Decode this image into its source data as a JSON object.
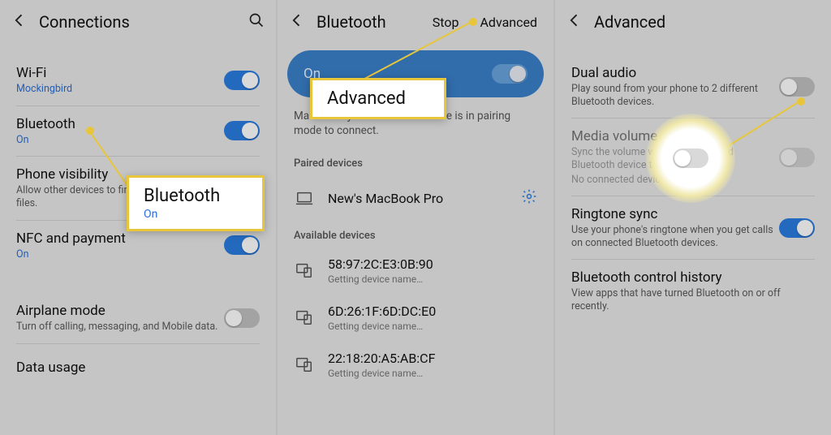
{
  "screen1": {
    "title": "Connections",
    "wifi": {
      "title": "Wi-Fi",
      "sub": "Mockingbird",
      "on": true
    },
    "bluetooth": {
      "title": "Bluetooth",
      "sub": "On",
      "on": true
    },
    "visibility": {
      "title": "Phone visibility",
      "sub": "Allow other devices to find your phone and transfer files."
    },
    "nfc": {
      "title": "NFC and payment",
      "sub": "On",
      "on": true
    },
    "airplane": {
      "title": "Airplane mode",
      "sub": "Turn off calling, messaging, and Mobile data.",
      "on": false
    },
    "data": {
      "title": "Data usage"
    },
    "callout": {
      "title": "Bluetooth",
      "sub": "On"
    }
  },
  "screen2": {
    "title": "Bluetooth",
    "stop": "Stop",
    "advanced": "Advanced",
    "pill_label": "On",
    "hint": "Make sure your Bluetooth device is in pairing mode to connect.",
    "paired_header": "Paired devices",
    "available_header": "Available devices",
    "paired": {
      "name": "New's MacBook Pro"
    },
    "avail": [
      {
        "mac": "58:97:2C:E3:0B:90",
        "status": "Getting device name…"
      },
      {
        "mac": "6D:26:1F:6D:DC:E0",
        "status": "Getting device name…"
      },
      {
        "mac": "22:18:20:A5:AB:CF",
        "status": "Getting device name…"
      }
    ],
    "callout": {
      "title": "Advanced"
    }
  },
  "screen3": {
    "title": "Advanced",
    "dual": {
      "title": "Dual audio",
      "sub": "Play sound from your phone to 2 different Bluetooth devices."
    },
    "media": {
      "title": "Media volume sync",
      "sub": "Sync the volume with the connected Bluetooth device to your phone.",
      "sub2": "No connected devices"
    },
    "ring": {
      "title": "Ringtone sync",
      "sub": "Use your phone's ringtone when you get calls on connected Bluetooth devices."
    },
    "history": {
      "title": "Bluetooth control history",
      "sub": "View apps that have turned Bluetooth on or off recently."
    }
  }
}
